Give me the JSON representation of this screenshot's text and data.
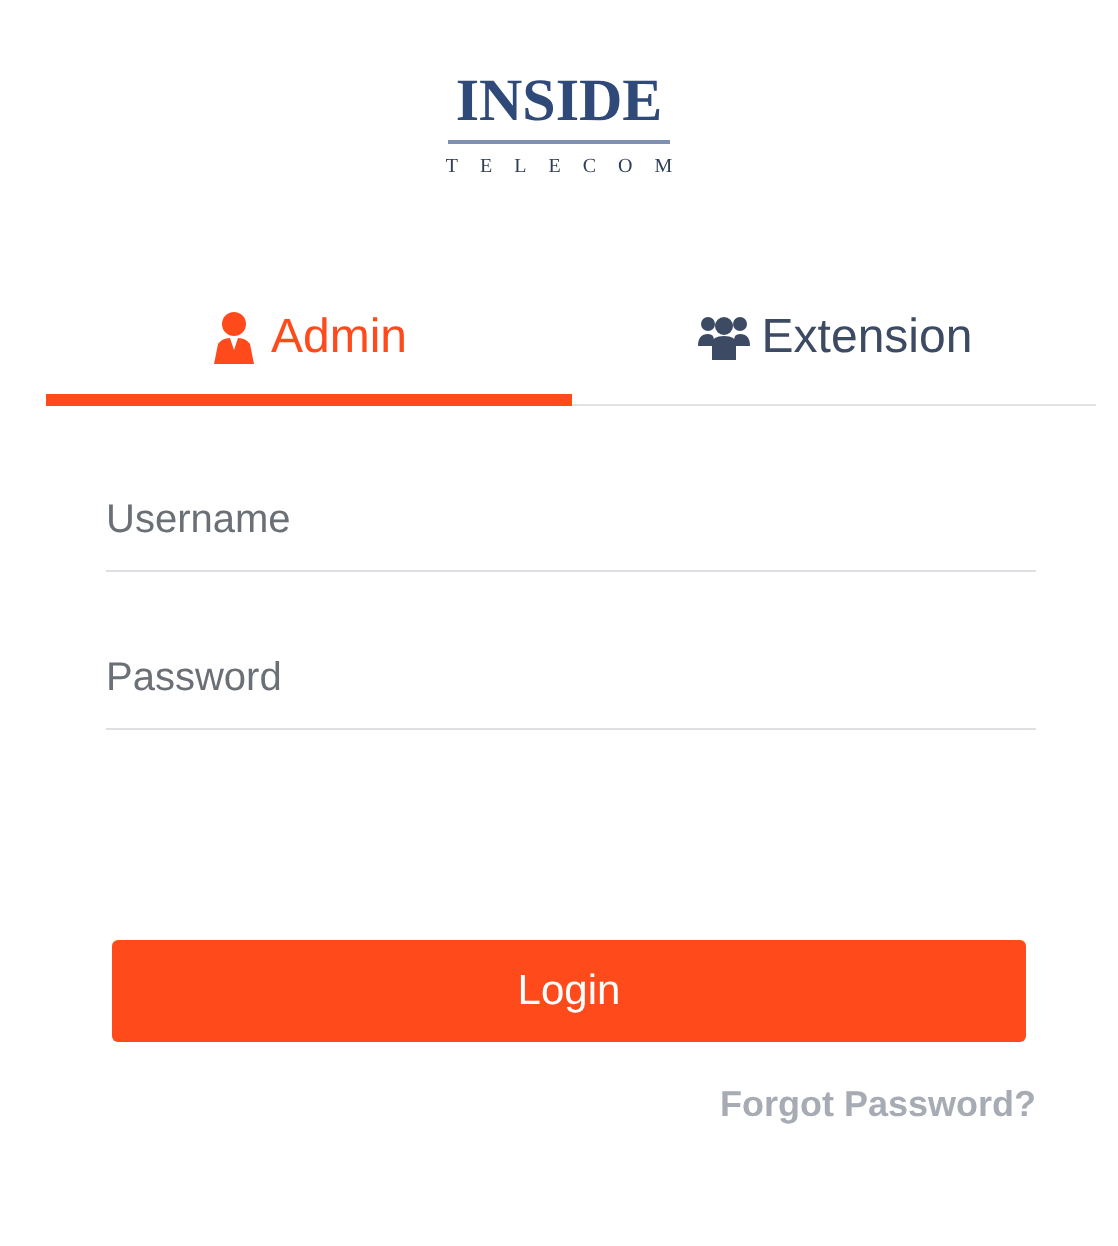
{
  "logo": {
    "name": "INSIDE",
    "tagline": "TELECOM"
  },
  "tabs": [
    {
      "label": "Admin",
      "kind": "admin",
      "selected": true
    },
    {
      "label": "Extension",
      "kind": "extension",
      "selected": false
    }
  ],
  "fields": [
    {
      "placeholder": "Username"
    },
    {
      "placeholder": "Password"
    }
  ],
  "login_button": "Login",
  "forgot_link": "Forgot Password?"
}
